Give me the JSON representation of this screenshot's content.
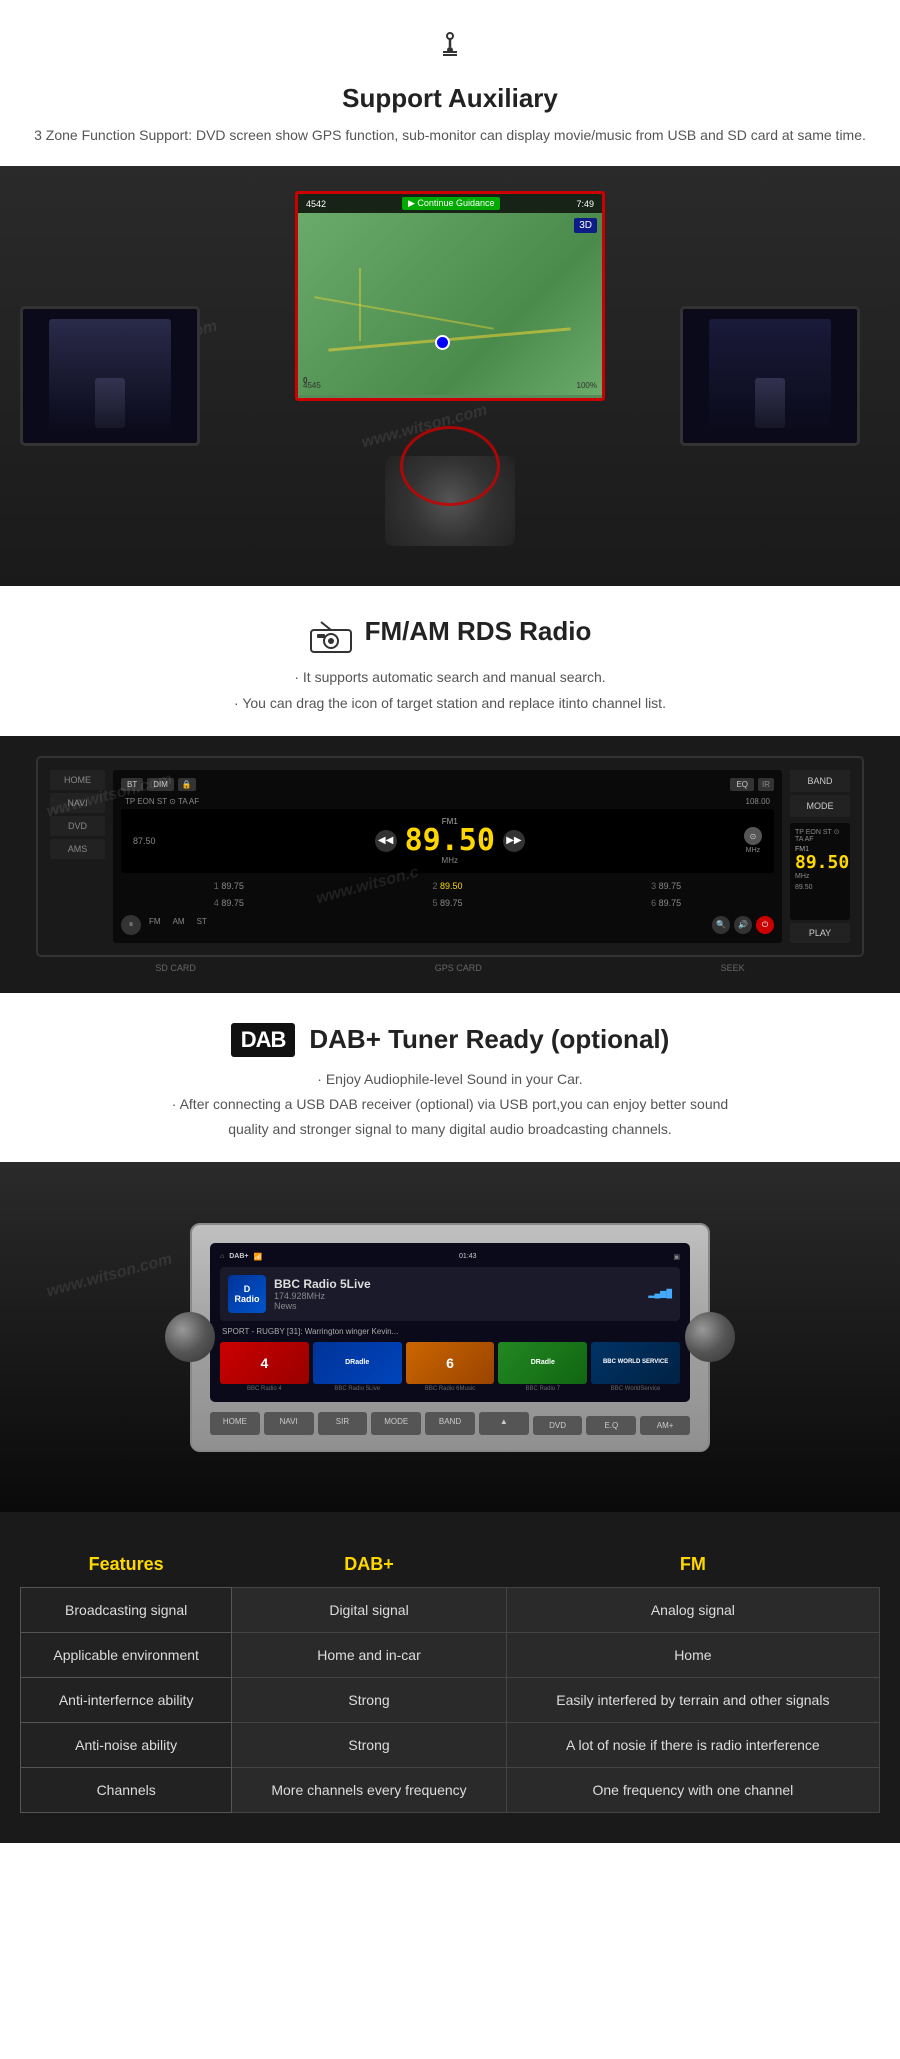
{
  "auxiliary": {
    "icon": "🎸",
    "title": "Support Auxiliary",
    "description": "3 Zone Function Support: DVD screen show GPS function, sub-monitor can display\nmovie/music from USB and SD card at same time."
  },
  "radio": {
    "icon": "📻",
    "title": "FM/AM RDS Radio",
    "desc_line1": "· It supports automatic search and manual search.",
    "desc_line2": "· You can drag the icon of target station and replace itinto channel list.",
    "freq_left": "87.50",
    "freq_right": "108.00",
    "freq_main": "89.50",
    "freq_unit": "MHz",
    "mode": "FM1",
    "presets": [
      {
        "num": "1",
        "freq": "89.75"
      },
      {
        "num": "2",
        "freq": "89.50",
        "active": true
      },
      {
        "num": "3",
        "freq": "89.75"
      },
      {
        "num": "4",
        "freq": "89.75"
      },
      {
        "num": "5",
        "freq": "89.75"
      },
      {
        "num": "6",
        "freq": "89.75"
      }
    ],
    "buttons_left": [
      "BT",
      "DIM"
    ],
    "buttons_right": [
      "EQ"
    ],
    "side_buttons": [
      "BAND",
      "MODE",
      "PLAY"
    ],
    "nav_buttons": [
      "HOME",
      "NAVI",
      "DVD",
      "AMS"
    ],
    "footer_buttons": [
      "SD CARD",
      "GPS CARD",
      "SEEK"
    ]
  },
  "dab": {
    "dab_label": "DAB",
    "title": "DAB+ Tuner Ready (optional)",
    "desc_line1": "· Enjoy Audiophile-level Sound in your Car.",
    "desc_line2": "· After connecting a USB DAB receiver (optional) via USB port,you can enjoy better sound",
    "desc_line3": "quality and stronger signal to many digital audio broadcasting channels.",
    "station_name": "BBC Radio 5Live",
    "station_freq": "174.928MHz",
    "station_type": "News",
    "station_program": "SPORT - RUGBY [31]: Warrington winger Kevin...",
    "channels": [
      {
        "name": "BBC Radio 4",
        "label": "4"
      },
      {
        "name": "BBC Radio 5Live",
        "label": "DRadle"
      },
      {
        "name": "BBC Radio 6Music",
        "label": "6"
      },
      {
        "name": "BBC Radio 7",
        "label": "DRadle"
      },
      {
        "name": "BBC WorldService",
        "label": "BBC WORLD SERVICE"
      }
    ],
    "hw_buttons": [
      "HOME",
      "NAVI",
      "SIR",
      "MODE",
      "BAND",
      "DVD",
      "E.Q",
      "AM+"
    ]
  },
  "comparison": {
    "header": {
      "col1": "Features",
      "col2": "DAB+",
      "col3": "FM"
    },
    "rows": [
      {
        "feature": "Broadcasting signal",
        "dab": "Digital signal",
        "fm": "Analog signal"
      },
      {
        "feature": "Applicable environment",
        "dab": "Home and in-car",
        "fm": "Home"
      },
      {
        "feature": "Anti-interfernce ability",
        "dab": "Strong",
        "fm": "Easily interfered by terrain and other signals"
      },
      {
        "feature": "Anti-noise ability",
        "dab": "Strong",
        "fm": "A lot of nosie if there is radio interference"
      },
      {
        "feature": "Channels",
        "dab": "More channels every frequency",
        "fm": "One frequency with one channel"
      }
    ]
  },
  "watermarks": [
    "www.witson.com",
    "www.witson.c"
  ]
}
